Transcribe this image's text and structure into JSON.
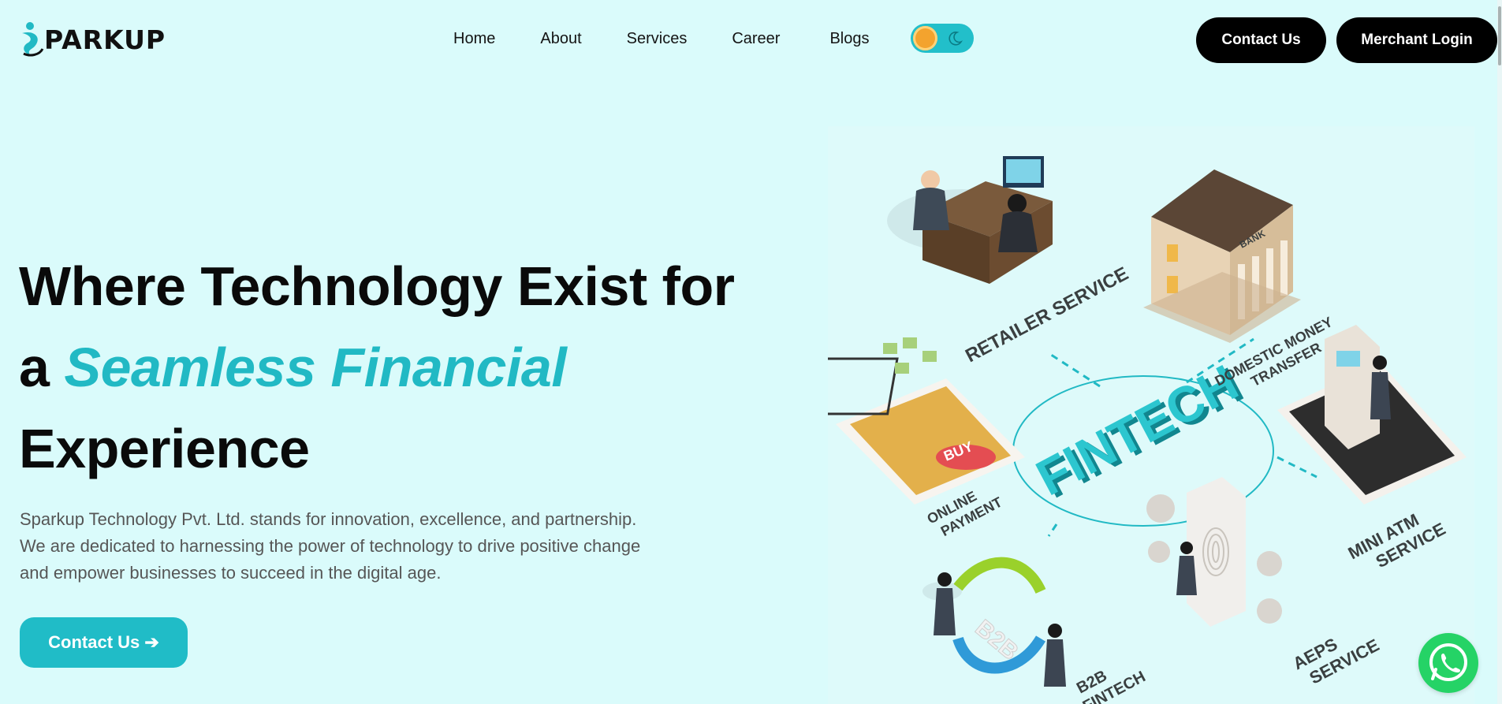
{
  "brand": {
    "name": "PARKUP",
    "accent_color": "#21b9c4"
  },
  "nav": {
    "links": [
      "Home",
      "About",
      "Services",
      "Career",
      "Blogs"
    ],
    "contact_label": "Contact Us",
    "merchant_label": "Merchant Login"
  },
  "theme_toggle": {
    "state": "light",
    "icons": [
      "sun-icon",
      "moon-icon"
    ]
  },
  "hero": {
    "title_line1": "Where Technology Exist for",
    "title_line2_prefix": "a",
    "title_line2_accent": "Seamless Financial",
    "title_line3": "Experience",
    "description": "Sparkup Technology Pvt. Ltd. stands for innovation, excellence, and partnership. We are dedicated to harnessing the power of technology to drive positive change and empower businesses to succeed in the digital age.",
    "cta_label": "Contact Us ➔"
  },
  "illustration": {
    "center_label": "FINTECH",
    "labels": {
      "retailer": "RETAILER SERVICE",
      "dmt_line1": "DOMESTIC MONEY",
      "dmt_line2": "TRANSFER",
      "online_line1": "ONLINE",
      "online_line2": "PAYMENT",
      "mini_atm_line1": "MINI ATM",
      "mini_atm_line2": "SERVICE",
      "aeps_line1": "AEPS",
      "aeps_line2": "SERVICE",
      "b2b_line1": "B2B",
      "b2b_line2": "FINTECH",
      "bank": "BANK",
      "buy": "BUY",
      "b2b_arrow": "B2B"
    }
  },
  "whatsapp": {
    "icon": "whatsapp-icon",
    "color": "#25d366"
  }
}
